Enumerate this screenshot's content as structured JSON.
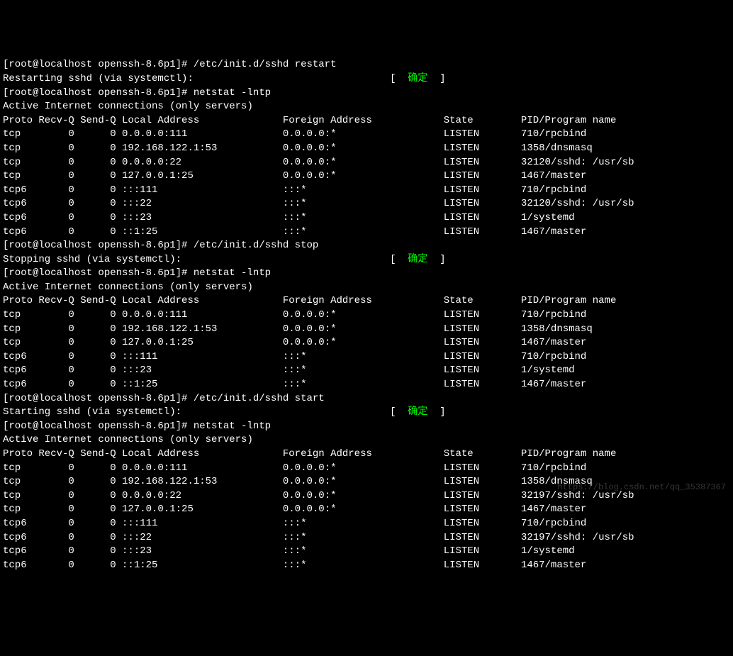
{
  "prompt": "[root@localhost openssh-8.6p1]# ",
  "cmd_restart": "/etc/init.d/sshd restart",
  "restart_msg": "Restarting sshd (via systemctl):",
  "ok_label": "确定",
  "cmd_netstat": "netstat -lntp",
  "active_header": "Active Internet connections (only servers)",
  "col": {
    "proto": "Proto",
    "recvq": "Recv-Q",
    "sendq": "Send-Q",
    "local": "Local Address",
    "foreign": "Foreign Address",
    "state": "State",
    "pid": "PID/Program name"
  },
  "block1": [
    {
      "proto": "tcp",
      "recvq": "0",
      "sendq": "0",
      "local": "0.0.0.0:111",
      "foreign": "0.0.0.0:*",
      "state": "LISTEN",
      "pid": "710/rpcbind"
    },
    {
      "proto": "tcp",
      "recvq": "0",
      "sendq": "0",
      "local": "192.168.122.1:53",
      "foreign": "0.0.0.0:*",
      "state": "LISTEN",
      "pid": "1358/dnsmasq"
    },
    {
      "proto": "tcp",
      "recvq": "0",
      "sendq": "0",
      "local": "0.0.0.0:22",
      "foreign": "0.0.0.0:*",
      "state": "LISTEN",
      "pid": "32120/sshd: /usr/sb"
    },
    {
      "proto": "tcp",
      "recvq": "0",
      "sendq": "0",
      "local": "127.0.0.1:25",
      "foreign": "0.0.0.0:*",
      "state": "LISTEN",
      "pid": "1467/master"
    },
    {
      "proto": "tcp6",
      "recvq": "0",
      "sendq": "0",
      "local": ":::111",
      "foreign": ":::*",
      "state": "LISTEN",
      "pid": "710/rpcbind"
    },
    {
      "proto": "tcp6",
      "recvq": "0",
      "sendq": "0",
      "local": ":::22",
      "foreign": ":::*",
      "state": "LISTEN",
      "pid": "32120/sshd: /usr/sb"
    },
    {
      "proto": "tcp6",
      "recvq": "0",
      "sendq": "0",
      "local": ":::23",
      "foreign": ":::*",
      "state": "LISTEN",
      "pid": "1/systemd"
    },
    {
      "proto": "tcp6",
      "recvq": "0",
      "sendq": "0",
      "local": "::1:25",
      "foreign": ":::*",
      "state": "LISTEN",
      "pid": "1467/master"
    }
  ],
  "cmd_stop": "/etc/init.d/sshd stop",
  "stop_msg": "Stopping sshd (via systemctl):",
  "block2": [
    {
      "proto": "tcp",
      "recvq": "0",
      "sendq": "0",
      "local": "0.0.0.0:111",
      "foreign": "0.0.0.0:*",
      "state": "LISTEN",
      "pid": "710/rpcbind"
    },
    {
      "proto": "tcp",
      "recvq": "0",
      "sendq": "0",
      "local": "192.168.122.1:53",
      "foreign": "0.0.0.0:*",
      "state": "LISTEN",
      "pid": "1358/dnsmasq"
    },
    {
      "proto": "tcp",
      "recvq": "0",
      "sendq": "0",
      "local": "127.0.0.1:25",
      "foreign": "0.0.0.0:*",
      "state": "LISTEN",
      "pid": "1467/master"
    },
    {
      "proto": "tcp6",
      "recvq": "0",
      "sendq": "0",
      "local": ":::111",
      "foreign": ":::*",
      "state": "LISTEN",
      "pid": "710/rpcbind"
    },
    {
      "proto": "tcp6",
      "recvq": "0",
      "sendq": "0",
      "local": ":::23",
      "foreign": ":::*",
      "state": "LISTEN",
      "pid": "1/systemd"
    },
    {
      "proto": "tcp6",
      "recvq": "0",
      "sendq": "0",
      "local": "::1:25",
      "foreign": ":::*",
      "state": "LISTEN",
      "pid": "1467/master"
    }
  ],
  "cmd_start": "/etc/init.d/sshd start",
  "start_msg": "Starting sshd (via systemctl):",
  "block3": [
    {
      "proto": "tcp",
      "recvq": "0",
      "sendq": "0",
      "local": "0.0.0.0:111",
      "foreign": "0.0.0.0:*",
      "state": "LISTEN",
      "pid": "710/rpcbind"
    },
    {
      "proto": "tcp",
      "recvq": "0",
      "sendq": "0",
      "local": "192.168.122.1:53",
      "foreign": "0.0.0.0:*",
      "state": "LISTEN",
      "pid": "1358/dnsmasq"
    },
    {
      "proto": "tcp",
      "recvq": "0",
      "sendq": "0",
      "local": "0.0.0.0:22",
      "foreign": "0.0.0.0:*",
      "state": "LISTEN",
      "pid": "32197/sshd: /usr/sb"
    },
    {
      "proto": "tcp",
      "recvq": "0",
      "sendq": "0",
      "local": "127.0.0.1:25",
      "foreign": "0.0.0.0:*",
      "state": "LISTEN",
      "pid": "1467/master"
    },
    {
      "proto": "tcp6",
      "recvq": "0",
      "sendq": "0",
      "local": ":::111",
      "foreign": ":::*",
      "state": "LISTEN",
      "pid": "710/rpcbind"
    },
    {
      "proto": "tcp6",
      "recvq": "0",
      "sendq": "0",
      "local": ":::22",
      "foreign": ":::*",
      "state": "LISTEN",
      "pid": "32197/sshd: /usr/sb"
    },
    {
      "proto": "tcp6",
      "recvq": "0",
      "sendq": "0",
      "local": ":::23",
      "foreign": ":::*",
      "state": "LISTEN",
      "pid": "1/systemd"
    },
    {
      "proto": "tcp6",
      "recvq": "0",
      "sendq": "0",
      "local": "::1:25",
      "foreign": ":::*",
      "state": "LISTEN",
      "pid": "1467/master"
    }
  ],
  "watermark": "https://blog.csdn.net/qq_35387367"
}
